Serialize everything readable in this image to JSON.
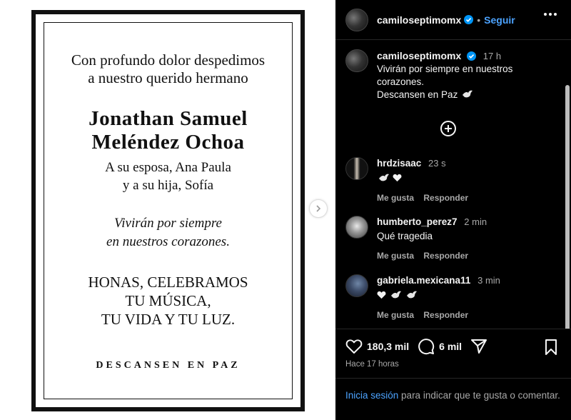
{
  "card": {
    "intro_line1": "Con profundo dolor despedimos",
    "intro_line2": "a nuestro querido hermano",
    "name_line1": "Jonathan Samuel",
    "name_line2": "Meléndez Ochoa",
    "family_line1": "A su esposa, Ana Paula",
    "family_line2": "y a su hija, Sofía",
    "quote_line1": "Vivirán por siempre",
    "quote_line2": "en nuestros corazones.",
    "tribute_line1": "HONAS, CELEBRAMOS",
    "tribute_line2": "TU MÚSICA,",
    "tribute_line3": "TU VIDA Y TU LUZ.",
    "closing": "DESCANSEN EN PAZ"
  },
  "header": {
    "username": "camiloseptimomx",
    "follow_label": "Seguir",
    "dot": "•"
  },
  "caption": {
    "username": "camiloseptimomx",
    "time": "17 h",
    "line1": "Vivirán por siempre en nuestros",
    "line2": "corazones.",
    "line3": "Descansen en Paz"
  },
  "comments": [
    {
      "user": "hrdzisaac",
      "time": "23 s",
      "text": "",
      "like_label": "Me gusta",
      "reply_label": "Responder"
    },
    {
      "user": "humberto_perez7",
      "time": "2 min",
      "text": "Qué tragedia",
      "like_label": "Me gusta",
      "reply_label": "Responder"
    },
    {
      "user": "gabriela.mexicana11",
      "time": "3 min",
      "text": "",
      "like_label": "Me gusta",
      "reply_label": "Responder"
    }
  ],
  "stats": {
    "likes": "180,3 mil",
    "comments": "6 mil",
    "posted": "Hace 17 horas"
  },
  "login": {
    "link": "Inicia sesión",
    "rest": " para indicar que te gusta o comentar."
  },
  "colors": {
    "link_blue": "#4ca3ff",
    "verified_blue": "#0095f6",
    "panel_bg": "#000000",
    "muted_text": "#a8a8a8"
  },
  "icons": [
    "verified-badge-icon",
    "more-options-icon",
    "add-comment-icon",
    "dove-emoji-icon",
    "white-heart-emoji-icon",
    "heart-icon",
    "comment-icon",
    "share-icon",
    "bookmark-icon",
    "next-arrow-icon"
  ]
}
